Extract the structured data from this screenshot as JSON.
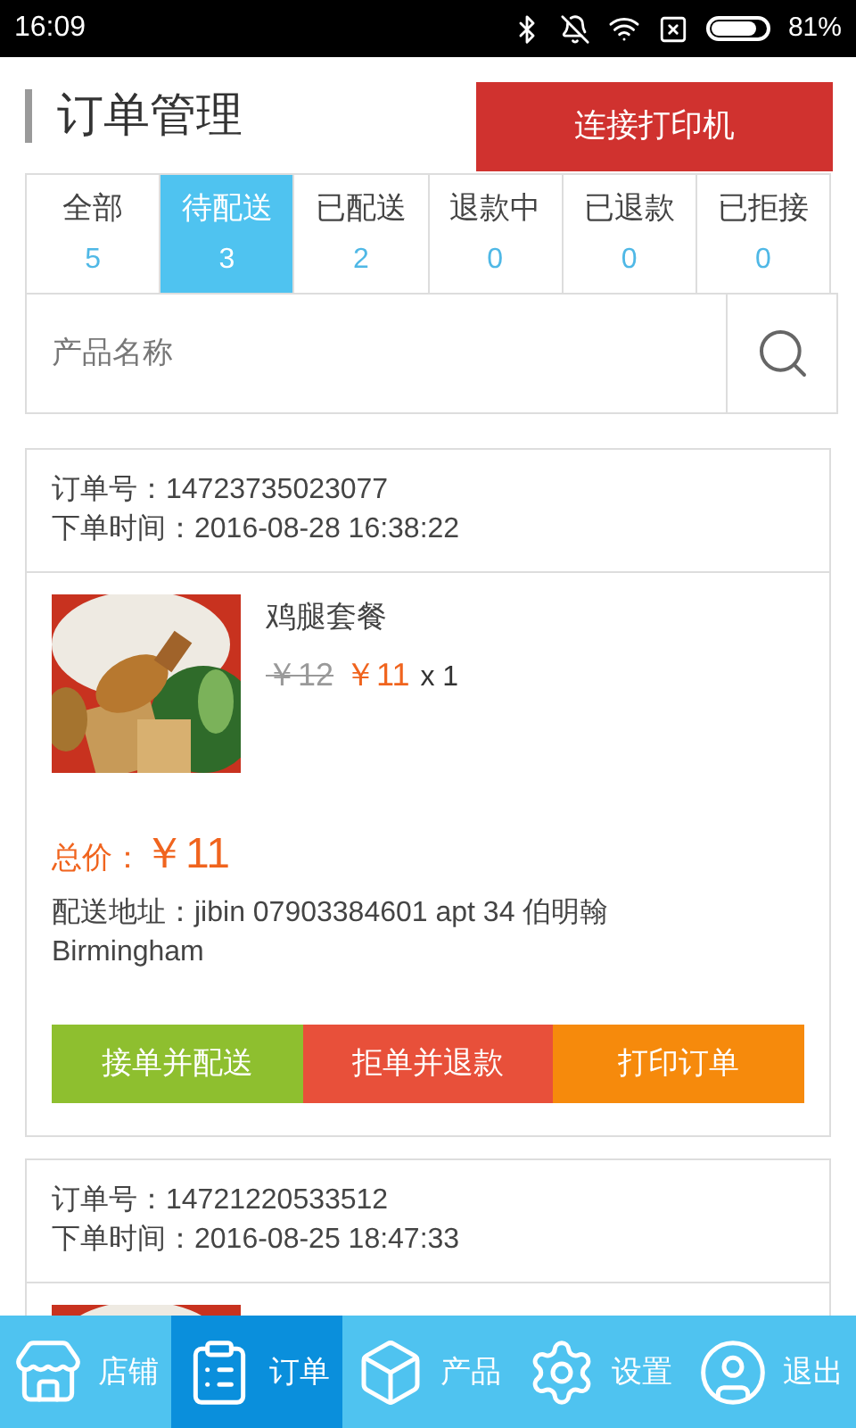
{
  "status_bar": {
    "time": "16:09",
    "battery": "81%"
  },
  "header": {
    "title": "订单管理",
    "connect_button": "连接打印机"
  },
  "tabs": [
    {
      "label": "全部",
      "count": "5",
      "selected": false
    },
    {
      "label": "待配送",
      "count": "3",
      "selected": true
    },
    {
      "label": "已配送",
      "count": "2",
      "selected": false
    },
    {
      "label": "退款中",
      "count": "0",
      "selected": false
    },
    {
      "label": "已退款",
      "count": "0",
      "selected": false
    },
    {
      "label": "已拒接",
      "count": "0",
      "selected": false
    }
  ],
  "search": {
    "placeholder": "产品名称"
  },
  "orders": [
    {
      "order_no": "订单号：14723735023077",
      "order_time": "下单时间：2016-08-28 16:38:22",
      "product": {
        "name": "鸡腿套餐",
        "old_price": "￥12",
        "price": "￥11",
        "quantity": "x 1"
      },
      "total_label": "总价：",
      "total": "￥11",
      "address": "配送地址：jibin 07903384601 apt 34 伯明翰 Birmingham",
      "actions": [
        {
          "label": "接单并配送",
          "kind": "accept"
        },
        {
          "label": "拒单并退款",
          "kind": "reject"
        },
        {
          "label": "打印订单",
          "kind": "print"
        }
      ]
    },
    {
      "order_no": "订单号：14721220533512",
      "order_time": "下单时间：2016-08-25 18:47:33"
    }
  ],
  "nav": [
    {
      "label": "店铺",
      "kind": "store",
      "selected": false
    },
    {
      "label": "订单",
      "kind": "orders",
      "selected": true
    },
    {
      "label": "产品",
      "kind": "products",
      "selected": false
    },
    {
      "label": "设置",
      "kind": "settings",
      "selected": false
    },
    {
      "label": "退出",
      "kind": "logout",
      "selected": false
    }
  ]
}
